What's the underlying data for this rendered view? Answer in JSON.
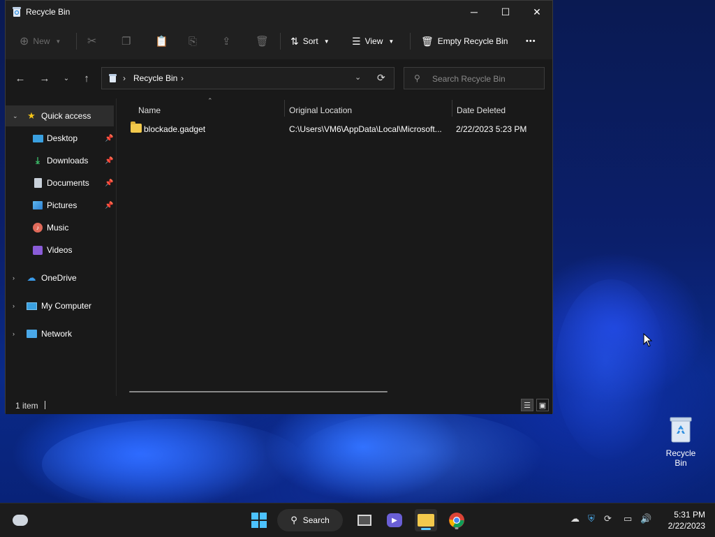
{
  "desktop": {
    "recycle_bin_label": "Recycle Bin"
  },
  "window": {
    "title": "Recycle Bin",
    "controls": {
      "minimize": "─",
      "maximize": "☐",
      "close": "✕"
    }
  },
  "toolbar": {
    "new_label": "New",
    "sort_label": "Sort",
    "view_label": "View",
    "empty_bin_label": "Empty Recycle Bin",
    "more_label": "•••"
  },
  "address_bar": {
    "breadcrumb": "Recycle Bin",
    "search_placeholder": "Search Recycle Bin"
  },
  "sidebar": {
    "quick_access": "Quick access",
    "items": [
      {
        "label": "Desktop",
        "pinned": true
      },
      {
        "label": "Downloads",
        "pinned": true
      },
      {
        "label": "Documents",
        "pinned": true
      },
      {
        "label": "Pictures",
        "pinned": true
      },
      {
        "label": "Music",
        "pinned": false
      },
      {
        "label": "Videos",
        "pinned": false
      }
    ],
    "onedrive": "OneDrive",
    "my_computer": "My Computer",
    "network": "Network"
  },
  "file_list": {
    "columns": [
      "Name",
      "Original Location",
      "Date Deleted"
    ],
    "rows": [
      {
        "name": "blockade.gadget",
        "original_location": "C:\\Users\\VM6\\AppData\\Local\\Microsoft...",
        "date_deleted": "2/22/2023 5:23 PM"
      }
    ]
  },
  "status_bar": {
    "item_count": "1 item"
  },
  "taskbar": {
    "search_label": "Search",
    "time": "5:31 PM",
    "date": "2/22/2023"
  },
  "colors": {
    "window_bg": "#191919",
    "toolbar_bg": "#202020",
    "taskbar_bg": "#1c1c1c",
    "accent": "#60cdff",
    "folder": "#f2c94c"
  }
}
